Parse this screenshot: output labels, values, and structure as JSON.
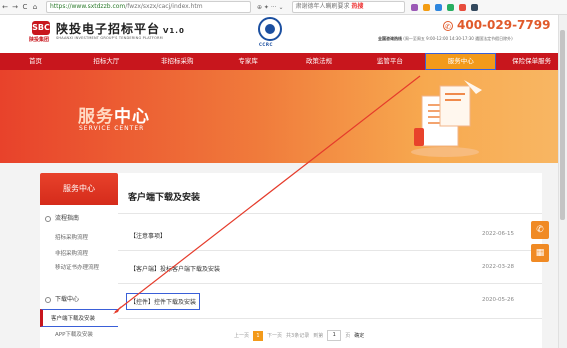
{
  "browser": {
    "url_host": "https://www.sxtdzzb.com",
    "url_path": "/fwzx/sxzx/cacj/index.htm",
    "search_text": "肃谢德年人瞒刷要求",
    "search_hot": "热搜",
    "nav_back": "←",
    "nav_forward": "→",
    "nav_reload": "C",
    "nav_home": "⌂"
  },
  "header": {
    "logo_mark": "SBC",
    "logo_sub": "陕投集团",
    "title": "陕投电子招标平台",
    "version": "V1.0",
    "subtitle_en": "SHAANXI INVESTMENT GROUP'S TENDERING PLATFORM",
    "ccrc_label": "CCRC",
    "phone": "400-029-7799",
    "hotline_label": "全国咨询热线",
    "hotline_hours": "(周一至周五 9:00-12:00 14:30-17:30 遇国法定节假日除外)"
  },
  "nav": {
    "items": [
      "首页",
      "招标大厅",
      "非招标采购",
      "专家库",
      "政策法规",
      "监管平台",
      "服务中心",
      "保险保单服务"
    ],
    "active_index": 6
  },
  "banner": {
    "title_main": "服务",
    "title_accent": "中心",
    "title_en": "SERVICE CENTER"
  },
  "sidebar": {
    "header": "服务中心",
    "group1": "流程指南",
    "links1": [
      "招标采购流程",
      "非招采购流程",
      "移动证书办理流程"
    ],
    "group2": "下载中心",
    "links2": [
      "客户端下载及安装",
      "APP下载及安装"
    ],
    "selected": "客户端下载及安装"
  },
  "main": {
    "title": "客户端下载及安装",
    "items": [
      {
        "title": "【注意事项】",
        "date": "2022-06-15"
      },
      {
        "title": "【客户端】投标客户端下载及安装",
        "date": "2022-03-28"
      },
      {
        "title": "【控件】控件下载及安装",
        "date": "2020-05-26"
      }
    ]
  },
  "pager": {
    "prev": "上一页",
    "current": "1",
    "next": "下一页",
    "total": "共3条记录",
    "goto": "到第",
    "page_input": "1",
    "page_unit": "页",
    "confirm": "确定"
  },
  "colors": {
    "brand_red": "#c8161d",
    "accent_orange": "#f39a1a",
    "highlight_blue": "#3a5fd8"
  }
}
